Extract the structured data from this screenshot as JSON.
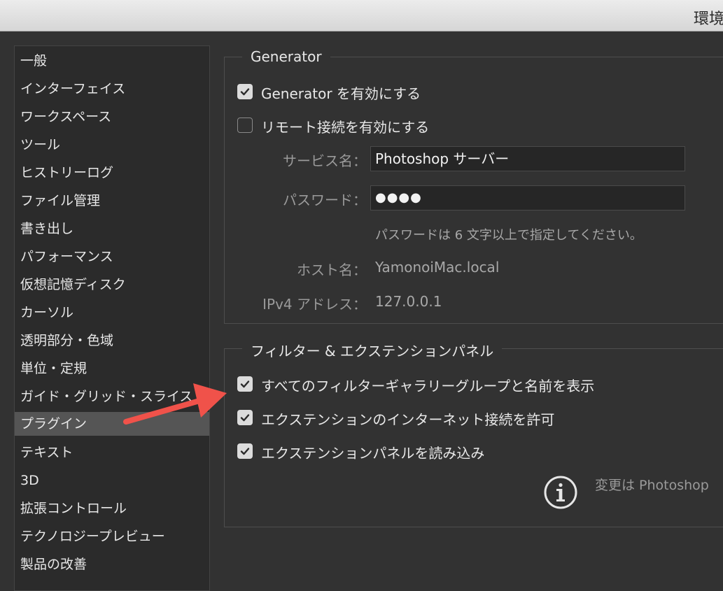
{
  "window": {
    "title": "環境"
  },
  "sidebar": {
    "items": [
      {
        "label": "一般"
      },
      {
        "label": "インターフェイス"
      },
      {
        "label": "ワークスペース"
      },
      {
        "label": "ツール"
      },
      {
        "label": "ヒストリーログ"
      },
      {
        "label": "ファイル管理"
      },
      {
        "label": "書き出し"
      },
      {
        "label": "パフォーマンス"
      },
      {
        "label": "仮想記憶ディスク"
      },
      {
        "label": "カーソル"
      },
      {
        "label": "透明部分・色域"
      },
      {
        "label": "単位・定規"
      },
      {
        "label": "ガイド・グリッド・スライス"
      },
      {
        "label": "プラグイン",
        "selected": true
      },
      {
        "label": "テキスト"
      },
      {
        "label": "3D"
      },
      {
        "label": "拡張コントロール"
      },
      {
        "label": "テクノロジープレビュー"
      },
      {
        "label": "製品の改善"
      }
    ]
  },
  "generator": {
    "legend": "Generator",
    "enable": {
      "label": "Generator を有効にする",
      "checked": true
    },
    "remote": {
      "label": "リモート接続を有効にする",
      "checked": false
    },
    "service_label": "サービス名：",
    "service_value": "Photoshop サーバー",
    "password_label": "パスワード：",
    "password_value": "●●●●",
    "password_hint": "パスワードは 6 文字以上で指定してください。",
    "host_label": "ホスト名：",
    "host_value": "YamonoiMac.local",
    "ip_label": "IPv4 アドレス：",
    "ip_value": "127.0.0.1"
  },
  "filters": {
    "legend": "フィルター & エクステンションパネル",
    "options": [
      {
        "label": "すべてのフィルターギャラリーグループと名前を表示",
        "checked": true
      },
      {
        "label": "エクステンションのインターネット接続を許可",
        "checked": true
      },
      {
        "label": "エクステンションパネルを読み込み",
        "checked": true
      }
    ],
    "note": "変更は Photoshop"
  },
  "colors": {
    "background": "#323232",
    "sidebar_bg": "#2b2b2b",
    "selected_item": "#555555",
    "annotation_arrow": "#f0524a"
  }
}
